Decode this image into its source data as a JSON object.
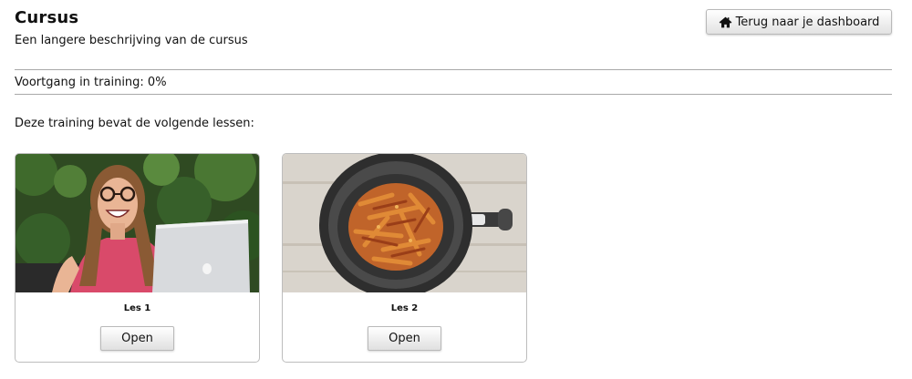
{
  "header": {
    "title": "Cursus",
    "description": "Een langere beschrijving van de cursus",
    "dashboard_button": {
      "icon": "home-icon",
      "label": "Terug naar je dashboard"
    }
  },
  "progress": {
    "text": "Voortgang in training: 0%",
    "value_percent": 0
  },
  "lessons_intro": "Deze training bevat de volgende lessen:",
  "lessons": [
    {
      "title": "Les 1",
      "button_label": "Open"
    },
    {
      "title": "Les 2",
      "button_label": "Open"
    }
  ],
  "colors": {
    "text": "#111111",
    "rule": "#a9a9a9",
    "card_border": "#bdbdbd",
    "button_top": "#ffffff",
    "button_bottom": "#e0e0e0"
  }
}
